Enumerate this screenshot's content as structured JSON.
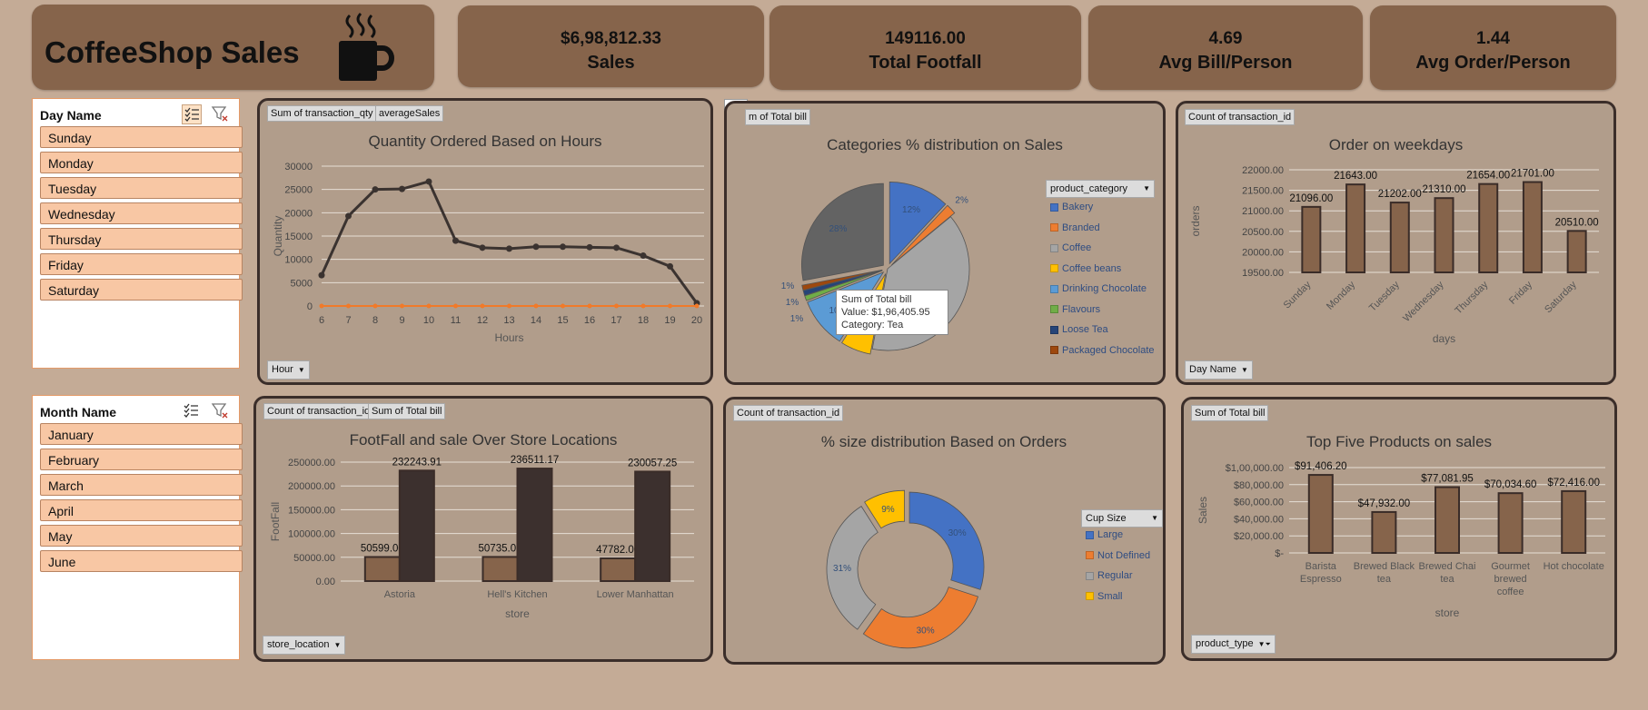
{
  "kpis": {
    "title": "CoffeeShop Sales",
    "sales_value": "$6,98,812.33",
    "sales_label": "Sales",
    "footfall_value": "149116.00",
    "footfall_label": "Total Footfall",
    "bill_value": "4.69",
    "bill_label": "Avg Bill/Person",
    "order_value": "1.44",
    "order_label": "Avg Order/Person"
  },
  "slicers": {
    "day": {
      "header": "Day Name",
      "items": [
        "Sunday",
        "Monday",
        "Tuesday",
        "Wednesday",
        "Thursday",
        "Friday",
        "Saturday"
      ]
    },
    "month": {
      "header": "Month Name",
      "items": [
        "January",
        "February",
        "March",
        "April",
        "May",
        "June"
      ]
    }
  },
  "panels": {
    "hours": {
      "tag1": "Sum of transaction_qty",
      "tag2": "averageSales",
      "filter": "Hour"
    },
    "categories": {
      "tag1": "m of Total bill"
    },
    "weekdays": {
      "tag1": "Count of transaction_id",
      "filter": "Day Name"
    },
    "store": {
      "tag1": "Count of transaction_id",
      "tag2": "Sum of Total bill",
      "filter": "store_location"
    },
    "size": {
      "tag1": "Count of transaction_id"
    },
    "products": {
      "tag1": "Sum of Total bill",
      "filter": "product_type"
    }
  },
  "colors": {
    "accent": "#86644b",
    "panel": "#b19d8b",
    "bar": "#86644b",
    "dark_bar": "#3c302e",
    "line": "#3b3330",
    "avg_line": "#f07a2a"
  },
  "chart_data": [
    {
      "type": "line",
      "title": "Quantity Ordered Based on Hours",
      "xlabel": "Hours",
      "ylabel": "Quantity",
      "x": [
        6,
        7,
        8,
        9,
        10,
        11,
        12,
        13,
        14,
        15,
        16,
        17,
        18,
        19,
        20
      ],
      "ylim": [
        0,
        30000
      ],
      "yticks": [
        0,
        5000,
        10000,
        15000,
        20000,
        25000,
        30000
      ],
      "series": [
        {
          "values": [
            6600,
            19300,
            25000,
            25100,
            26700,
            14000,
            12500,
            12300,
            12700,
            12700,
            12600,
            12500,
            10800,
            8500,
            600
          ]
        },
        {
          "values": [
            0,
            0,
            0,
            0,
            0,
            0,
            0,
            0,
            0,
            0,
            0,
            0,
            0,
            0,
            0
          ]
        }
      ]
    },
    {
      "type": "pie",
      "title": "Categories % distribution on Sales",
      "legend_title": "product_category",
      "legend": [
        "Bakery",
        "Branded",
        "Coffee",
        "Coffee beans",
        "Drinking Chocolate",
        "Flavours",
        "Loose Tea",
        "Packaged Chocolate"
      ],
      "slices": [
        {
          "label": "Bakery",
          "pct": 12,
          "color": "#4472c4"
        },
        {
          "label": "Branded",
          "pct": 2,
          "color": "#ed7d31"
        },
        {
          "label": "Coffee",
          "pct": 39,
          "color": "#a5a5a5"
        },
        {
          "label": "Coffee beans",
          "pct": 6,
          "color": "#ffc000"
        },
        {
          "label": "Drinking Chocolate",
          "pct": 10,
          "color": "#5b9bd5"
        },
        {
          "label": "Flavours",
          "pct": 1,
          "color": "#70ad47"
        },
        {
          "label": "Loose Tea",
          "pct": 1,
          "color": "#264478"
        },
        {
          "label": "Packaged Chocolate",
          "pct": 1,
          "color": "#9e480e"
        },
        {
          "label": "Tea",
          "pct": 28,
          "color": "#636363"
        }
      ],
      "tooltip": {
        "line1": "Sum of Total bill",
        "line2": "Value:  $1,96,405.95",
        "line3": "Category: Tea"
      }
    },
    {
      "type": "bar",
      "title": "Order on weekdays",
      "xlabel": "days",
      "ylabel": "orders",
      "categories": [
        "Sunday",
        "Monday",
        "Tuesday",
        "Wednesday",
        "Thursday",
        "Friday",
        "Saturday"
      ],
      "values": [
        21096,
        21643,
        21202,
        21310,
        21654,
        21701,
        20510
      ],
      "labels": [
        "21096.00",
        "21643.00",
        "21202.00",
        "21310.00",
        "21654.00",
        "21701.00",
        "20510.00"
      ],
      "ylim": [
        19500,
        22000
      ],
      "yticks": [
        "19500.00",
        "20000.00",
        "20500.00",
        "21000.00",
        "21500.00",
        "22000.00"
      ]
    },
    {
      "type": "bar",
      "title": "FootFall and sale Over Store Locations",
      "xlabel": "store",
      "ylabel": "FootFall",
      "categories": [
        "Astoria",
        "Hell's Kitchen",
        "Lower Manhattan"
      ],
      "series": [
        {
          "values": [
            50599,
            50735,
            47782
          ],
          "labels": [
            "50599.00",
            "50735.00",
            "47782.00"
          ]
        },
        {
          "values": [
            232243.91,
            236511.17,
            230057.25
          ],
          "labels": [
            "232243.91",
            "236511.17",
            "230057.25"
          ]
        }
      ],
      "ylim": [
        0,
        250000
      ],
      "yticks": [
        "0.00",
        "50000.00",
        "100000.00",
        "150000.00",
        "200000.00",
        "250000.00"
      ]
    },
    {
      "type": "pie",
      "title": "% size distribution Based on Orders",
      "legend_title": "Cup Size",
      "legend": [
        "Large",
        "Not Defined",
        "Regular",
        "Small"
      ],
      "slices": [
        {
          "label": "Large",
          "pct": 30,
          "color": "#4472c4"
        },
        {
          "label": "Not Defined",
          "pct": 30,
          "color": "#ed7d31"
        },
        {
          "label": "Regular",
          "pct": 31,
          "color": "#a5a5a5"
        },
        {
          "label": "Small",
          "pct": 9,
          "color": "#ffc000"
        }
      ]
    },
    {
      "type": "bar",
      "title": "Top Five Products on sales",
      "xlabel": "store",
      "ylabel": "Sales",
      "categories": [
        [
          "Barista",
          "Espresso"
        ],
        [
          "Brewed Black",
          "tea"
        ],
        [
          "Brewed Chai",
          "tea"
        ],
        [
          "Gourmet",
          "brewed",
          "coffee"
        ],
        [
          "Hot chocolate"
        ]
      ],
      "values": [
        91406.2,
        47932.0,
        77081.95,
        70034.6,
        72416.0
      ],
      "labels": [
        "$91,406.20",
        "$47,932.00",
        "$77,081.95",
        "$70,034.60",
        "$72,416.00"
      ],
      "ylim": [
        0,
        100000
      ],
      "yticks": [
        "$-",
        "$20,000.00",
        "$40,000.00",
        "$60,000.00",
        "$80,000.00",
        "$1,00,000.00"
      ]
    }
  ]
}
